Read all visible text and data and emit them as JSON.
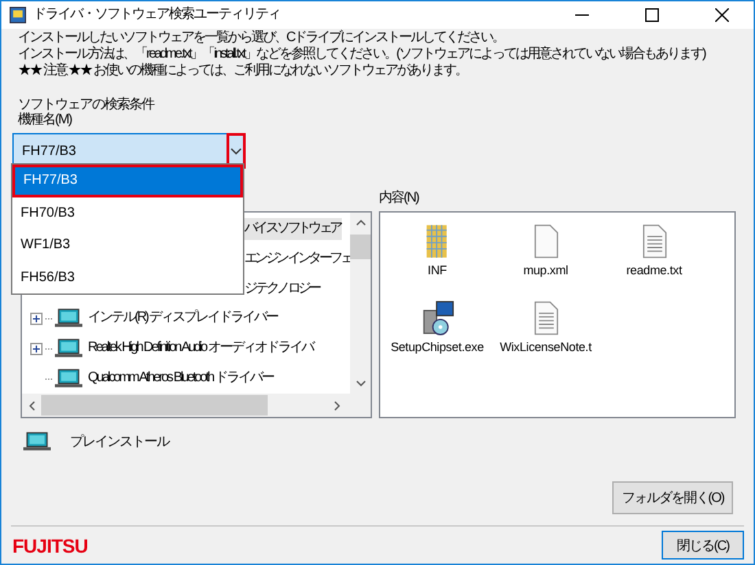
{
  "window": {
    "title": "ドライバ・ソフトウェア検索ユーティリティ"
  },
  "instructions": [
    "インストールしたいソフトウェアを一覧から選び、Cドライブにインストールしてください。",
    "インストール方法は、「readme.txt」「install.txt」などを参照してください。(ソフトウェアによっては用意されていない場合もあります)",
    "★★ 注意 ★★ お使いの機種によっては、ご利用になれないソフトウェアがあります。"
  ],
  "search_section": {
    "title": "ソフトウェアの検索条件",
    "model_label": "機種名(M)",
    "model_value": "FH77/B3"
  },
  "model_options": [
    {
      "label": "FH77/B3",
      "selected": true
    },
    {
      "label": "FH70/B3",
      "selected": false
    },
    {
      "label": "WF1/B3",
      "selected": false
    },
    {
      "label": "FH56/B3",
      "selected": false
    }
  ],
  "tree": [
    {
      "label": "バイス ソフトウェア",
      "selected": true,
      "partial": true
    },
    {
      "label": "エンジン インターフェ",
      "selected": false,
      "partial": true
    },
    {
      "label": "ジ テクノロジー",
      "selected": false,
      "partial": true
    },
    {
      "label": "インテル(R) ディスプレイドライバー",
      "selected": false,
      "expandable": true,
      "partial": false
    },
    {
      "label": "Realtek High Definition Audio オーディオドライバ",
      "selected": false,
      "expandable": true,
      "partial": false
    },
    {
      "label": "Qualcomm Atheros Bluetooth ドライバー",
      "selected": false,
      "expandable": false,
      "partial": false
    }
  ],
  "contents": {
    "label": "内容(N)",
    "files": [
      {
        "name": "INF",
        "kind": "folder"
      },
      {
        "name": "mup.xml",
        "kind": "file"
      },
      {
        "name": "readme.txt",
        "kind": "text"
      },
      {
        "name": "SetupChipset.exe",
        "kind": "setup"
      },
      {
        "name": "WixLicenseNote.t",
        "kind": "text"
      }
    ]
  },
  "legend": {
    "label": "プレインストール"
  },
  "buttons": {
    "open_folder": "フォルダを開く(O)",
    "close": "閉じる(C)"
  },
  "logo": "FUJITSU"
}
